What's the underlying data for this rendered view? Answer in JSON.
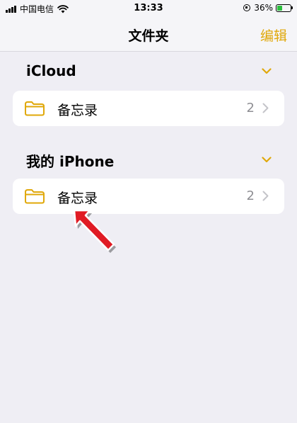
{
  "status_bar": {
    "carrier": "中国电信",
    "time": "13:33",
    "battery_percent": "36%",
    "battery_level": 0.36
  },
  "nav": {
    "title": "文件夹",
    "edit_label": "编辑"
  },
  "sections": [
    {
      "title": "iCloud",
      "folders": [
        {
          "label": "备忘录",
          "count": "2"
        }
      ]
    },
    {
      "title": "我的 iPhone",
      "folders": [
        {
          "label": "备忘录",
          "count": "2"
        }
      ]
    }
  ],
  "colors": {
    "accent": "#e0a80a",
    "background": "#efeef4",
    "annotation": "#e01b24"
  },
  "icons": [
    "signal-icon",
    "wifi-icon",
    "rotation-lock-icon",
    "battery-icon",
    "chevron-down-icon",
    "folder-icon",
    "chevron-right-icon",
    "annotation-arrow"
  ]
}
